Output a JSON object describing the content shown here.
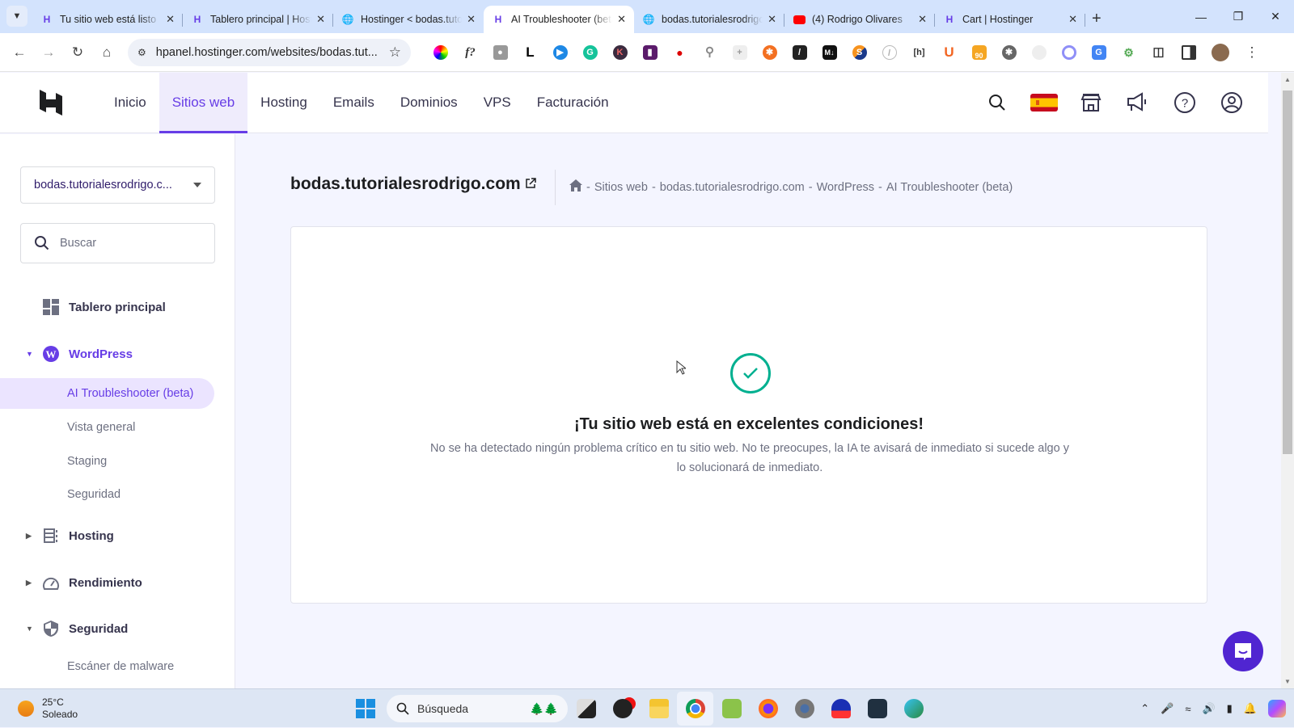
{
  "browser": {
    "tabs": [
      {
        "title": "Tu sitio web está listo",
        "favicon": "hostinger-icon",
        "active": false
      },
      {
        "title": "Tablero principal | Hostinger",
        "favicon": "hostinger-icon",
        "active": false
      },
      {
        "title": "Hostinger < bodas.tutorialesrodrigo",
        "favicon": "globe-icon",
        "active": false
      },
      {
        "title": "AI Troubleshooter (beta)",
        "favicon": "hostinger-icon",
        "active": true
      },
      {
        "title": "bodas.tutorialesrodrigo",
        "favicon": "globe-icon",
        "active": false
      },
      {
        "title": "(4) Rodrigo Olivares",
        "favicon": "youtube-icon",
        "active": false
      },
      {
        "title": "Cart | Hostinger",
        "favicon": "hostinger-icon",
        "active": false
      }
    ],
    "url": "hpanel.hostinger.com/websites/bodas.tut...",
    "extension_badge": "90"
  },
  "header": {
    "nav": [
      {
        "label": "Inicio",
        "active": false
      },
      {
        "label": "Sitios web",
        "active": true
      },
      {
        "label": "Hosting",
        "active": false
      },
      {
        "label": "Emails",
        "active": false
      },
      {
        "label": "Dominios",
        "active": false
      },
      {
        "label": "VPS",
        "active": false
      },
      {
        "label": "Facturación",
        "active": false
      }
    ]
  },
  "sidebar": {
    "site_select": "bodas.tutorialesrodrigo.c...",
    "search_placeholder": "Buscar",
    "items": [
      {
        "label": "Tablero principal"
      },
      {
        "label": "WordPress",
        "expanded": true
      },
      {
        "label": "Hosting",
        "expanded": false
      },
      {
        "label": "Rendimiento",
        "expanded": false
      },
      {
        "label": "Seguridad",
        "expanded": true
      }
    ],
    "wordpress_sub": [
      "AI Troubleshooter (beta)",
      "Vista general",
      "Staging",
      "Seguridad"
    ],
    "seguridad_sub": [
      "Escáner de malware"
    ]
  },
  "main": {
    "title": "bodas.tutorialesrodrigo.com",
    "breadcrumb": [
      "Sitios web",
      "bodas.tutorialesrodrigo.com",
      "WordPress",
      "AI Troubleshooter (beta)"
    ],
    "breadcrumb_sep": "-",
    "status_heading": "¡Tu sitio web está en excelentes condiciones!",
    "status_text": "No se ha detectado ningún problema crítico en tu sitio web. No te preocupes, la IA te avisará de inmediato si sucede algo y lo solucionará de inmediato."
  },
  "colors": {
    "accent": "#673de6",
    "success": "#00b090",
    "chat": "#5025d1"
  },
  "taskbar": {
    "temperature": "25°C",
    "weather": "Soleado",
    "search_placeholder": "Búsqueda"
  }
}
